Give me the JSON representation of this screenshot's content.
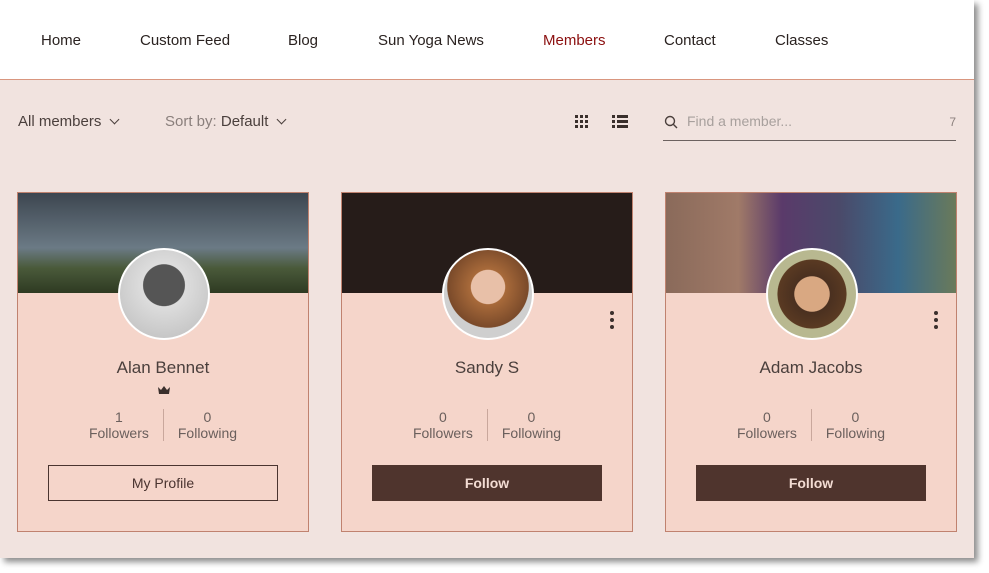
{
  "nav": {
    "items": [
      "Home",
      "Custom Feed",
      "Blog",
      "Sun Yoga News",
      "Members",
      "Contact",
      "Classes"
    ],
    "active": "Members"
  },
  "toolbar": {
    "filter": "All members",
    "sort_label": "Sort by:",
    "sort_value": "Default",
    "search_placeholder": "Find a member...",
    "member_count": "7"
  },
  "colors": {
    "accent": "#8b0f0f",
    "button": "#4f342d",
    "card_bg": "#f5d5ca",
    "page_bg": "#f1e3df"
  },
  "members": [
    {
      "name": "Alan Bennet",
      "followers": "1",
      "followers_label": "Followers",
      "following": "0",
      "following_label": "Following",
      "button": "My Profile",
      "badge": "crown-icon"
    },
    {
      "name": "Sandy S",
      "followers": "0",
      "followers_label": "Followers",
      "following": "0",
      "following_label": "Following",
      "button": "Follow"
    },
    {
      "name": "Adam Jacobs",
      "followers": "0",
      "followers_label": "Followers",
      "following": "0",
      "following_label": "Following",
      "button": "Follow"
    }
  ]
}
